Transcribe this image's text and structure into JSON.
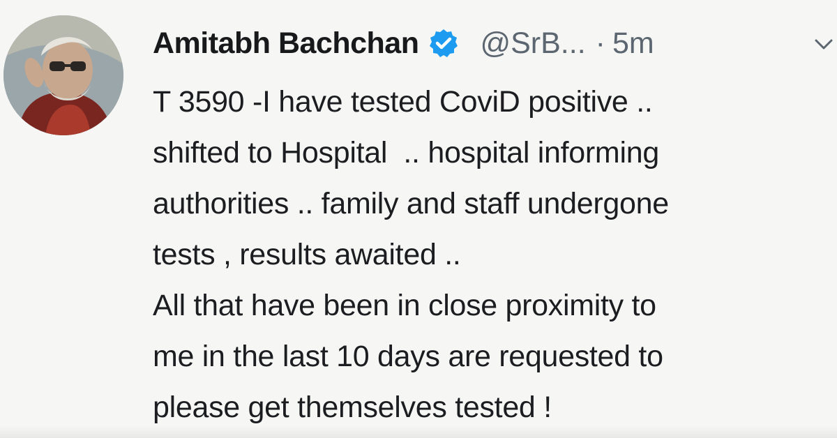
{
  "tweet": {
    "author": {
      "display_name": "Amitabh Bachchan",
      "handle": "@SrB...",
      "verified_icon": "verified-badge-icon",
      "avatar": "profile-photo"
    },
    "separator": "·",
    "timestamp": "5m",
    "menu_icon": "chevron-down-icon",
    "lines": [
      "T 3590 -I have tested CoviD positive ..",
      "shifted to Hospital  .. hospital informing",
      "authorities .. family and staff undergone",
      "tests , results awaited ..",
      "All that have been in close proximity to",
      "me in the last 10 days are requested to",
      "please get themselves tested !"
    ]
  },
  "colors": {
    "background": "#f6f6f4",
    "text": "#1b1d20",
    "muted": "#5b6670",
    "verified": "#1d9bf0"
  }
}
